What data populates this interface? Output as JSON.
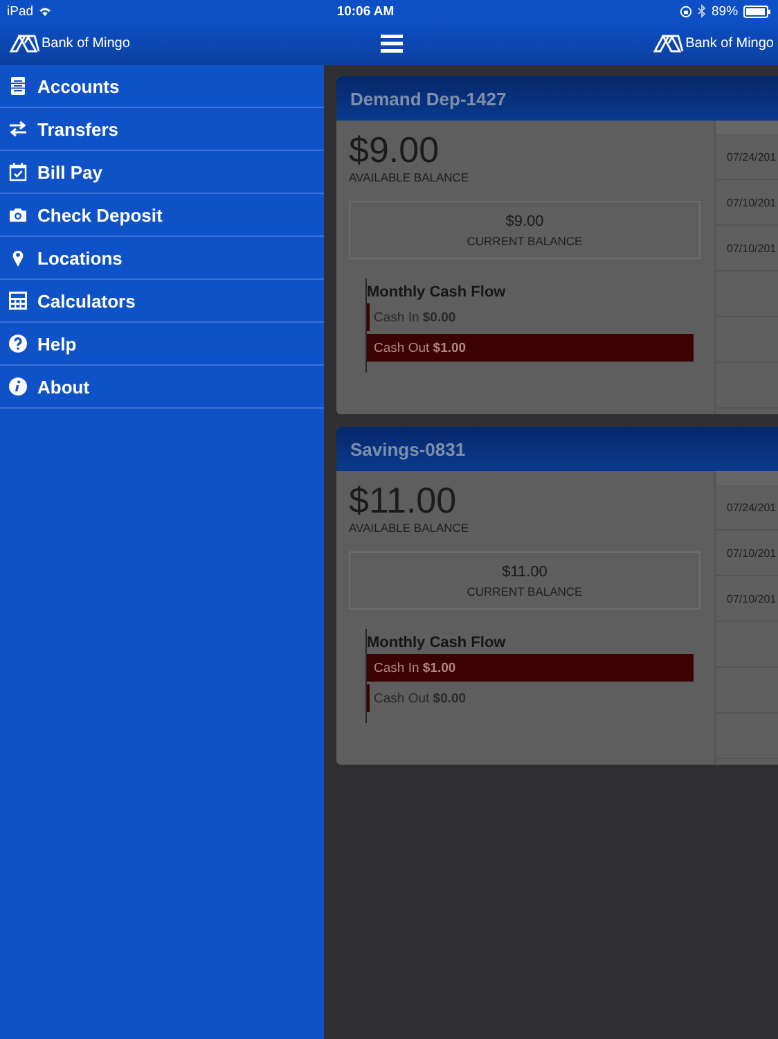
{
  "status_bar": {
    "device": "iPad",
    "time": "10:06 AM",
    "battery": "89%"
  },
  "nav_bar": {
    "left_logo": "Bank of Mingo",
    "right_logo": "Bank of Mingo"
  },
  "sidebar": {
    "items": [
      {
        "label": "Accounts"
      },
      {
        "label": "Transfers"
      },
      {
        "label": "Bill Pay"
      },
      {
        "label": "Check Deposit"
      },
      {
        "label": "Locations"
      },
      {
        "label": "Calculators"
      },
      {
        "label": "Help"
      },
      {
        "label": "About"
      }
    ]
  },
  "accounts": [
    {
      "name": "Demand Dep-1427",
      "available_balance": "$9.00",
      "available_label": "AVAILABLE BALANCE",
      "current_balance": "$9.00",
      "current_label": "CURRENT BALANCE",
      "cash_flow": {
        "title": "Monthly Cash Flow",
        "rows": [
          {
            "label": "Cash In",
            "amount": "$0.00",
            "level": 0
          },
          {
            "label": "Cash Out",
            "amount": "$1.00",
            "level": 1
          }
        ]
      },
      "dates": [
        "07/24/201",
        "07/10/201",
        "07/10/201"
      ]
    },
    {
      "name": "Savings-0831",
      "available_balance": "$11.00",
      "available_label": "AVAILABLE BALANCE",
      "current_balance": "$11.00",
      "current_label": "CURRENT BALANCE",
      "cash_flow": {
        "title": "Monthly Cash Flow",
        "rows": [
          {
            "label": "Cash In",
            "amount": "$1.00",
            "level": 1
          },
          {
            "label": "Cash Out",
            "amount": "$0.00",
            "level": 0
          }
        ]
      },
      "dates": [
        "07/24/201",
        "07/10/201",
        "07/10/201"
      ]
    }
  ]
}
